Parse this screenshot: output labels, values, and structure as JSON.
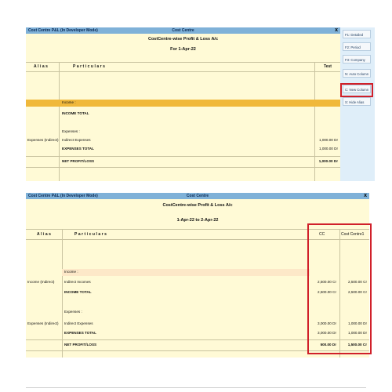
{
  "top": {
    "title_left": "Cost Centre P&L (In Developer Mode)",
    "title_center": "Cost Centre",
    "close": "x",
    "report_title": "CostCentre-wise Profit & Loss A/c",
    "period": "For 1-Apr-22",
    "col_alias": "Alias",
    "col_particulars": "Particulars",
    "col_test": "Test",
    "income_group": "Income :",
    "income_total": "INCOME TOTAL",
    "expenses_group": "Expenses :",
    "expenses_alias": "Expenses (Indirect)",
    "indirect_expenses": "Indirect Expenses",
    "indirect_expenses_value": "1,000.00 Dr",
    "expenses_total": "EXPENSES TOTAL",
    "expenses_total_value": "1,000.00 Dr",
    "net": "NET PROFIT/LOSS",
    "net_value": "1,000.00 Dr",
    "sidebar": {
      "detailed": "F1: Detailed",
      "period": "F2: Period",
      "company": "F3: Company",
      "auto_column": "N: Auto Column",
      "new_column": "C: New Column",
      "hide_alias": "S: Hide Alias"
    },
    "accent": "#d0202a"
  },
  "bottom": {
    "title_left": "Cost Centre P&L (In Developer Mode)",
    "title_center": "Cost Centre",
    "close": "x",
    "report_title": "CostCentre-wise Profit & Loss A/c",
    "period": "1-Apr-22 to 2-Apr-22",
    "col_alias": "Alias",
    "col_particulars": "Particulars",
    "col_cc": "CC",
    "col_cost_centre1": "Cost Centre1",
    "income_group": "Income :",
    "income_alias": "Income (Indirect)",
    "indirect_incomes": "Indirect Incomes",
    "indirect_incomes_cc": "2,500.00 Cr",
    "indirect_incomes_cc1": "2,500.00 Cr",
    "income_total": "INCOME TOTAL",
    "income_total_cc": "2,500.00 Cr",
    "income_total_cc1": "2,500.00 Cr",
    "expenses_group": "Expenses :",
    "expenses_alias": "Expenses (Indirect)",
    "indirect_expenses": "Indirect Expenses",
    "indirect_expenses_cc": "3,000.00 Dr",
    "indirect_expenses_cc1": "1,000.00 Dr",
    "expenses_total": "EXPENSES TOTAL",
    "expenses_total_cc": "3,000.00 Dr",
    "expenses_total_cc1": "1,000.00 Dr",
    "net": "NET PROFIT/LOSS",
    "net_cc": "500.00 Dr",
    "net_cc1": "1,500.00 Cr"
  }
}
